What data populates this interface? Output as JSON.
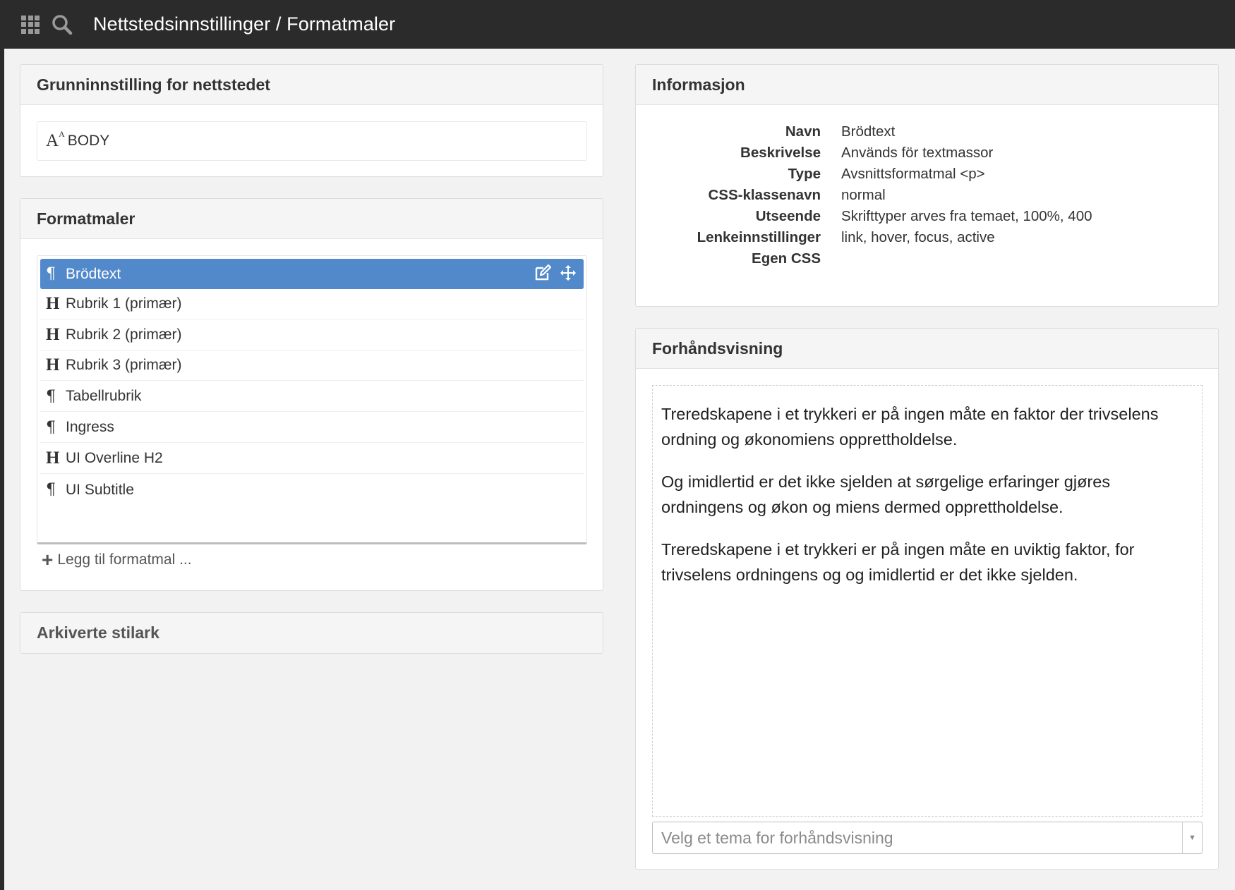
{
  "header": {
    "title": "Nettstedsinnstillinger / Formatmaler"
  },
  "base_panel": {
    "title": "Grunninnstilling for nettstedet",
    "body_label": "BODY"
  },
  "formats_panel": {
    "title": "Formatmaler",
    "items": [
      {
        "label": "Brödtext",
        "icon": "paragraph-icon",
        "active": true
      },
      {
        "label": "Rubrik 1 (primær)",
        "icon": "heading-icon"
      },
      {
        "label": "Rubrik 2 (primær)",
        "icon": "heading-icon"
      },
      {
        "label": "Rubrik 3 (primær)",
        "icon": "heading-icon"
      },
      {
        "label": "Tabellrubrik",
        "icon": "paragraph-icon"
      },
      {
        "label": "Ingress",
        "icon": "paragraph-icon"
      },
      {
        "label": "UI Overline H2",
        "icon": "heading-icon"
      },
      {
        "label": "UI Subtitle",
        "icon": "paragraph-icon"
      }
    ],
    "add_label": "Legg til formatmal ..."
  },
  "archived_panel": {
    "title": "Arkiverte stilark"
  },
  "info_panel": {
    "title": "Informasjon",
    "rows": [
      {
        "key": "Navn",
        "value": "Brödtext"
      },
      {
        "key": "Beskrivelse",
        "value": "Används för textmassor"
      },
      {
        "key": "Type",
        "value": "Avsnittsformatmal <p>"
      },
      {
        "key": "CSS-klassenavn",
        "value": "normal"
      },
      {
        "key": "Utseende",
        "value": "Skrifttyper arves fra temaet, 100%, 400"
      },
      {
        "key": "Lenkeinnstillinger",
        "value": "link, hover, focus, active"
      },
      {
        "key": "Egen CSS",
        "value": ""
      }
    ]
  },
  "preview_panel": {
    "title": "Forhåndsvisning",
    "paragraphs": [
      "Treredskapene i et trykkeri er på ingen måte en faktor der trivselens ordning og økonomiens opprettholdelse.",
      "Og imidlertid er det ikke sjelden at sørgelige erfaringer gjøres ordningens og økon og miens dermed opprettholdelse.",
      "Treredskapene i et trykkeri er på ingen måte en uviktig faktor, for trivselens ordningens og og imidlertid er det ikke sjelden."
    ],
    "theme_placeholder": "Velg et tema for forhåndsvisning"
  },
  "colors": {
    "topbar": "#2b2b2b",
    "active_item": "#5289cb",
    "panel_header": "#f5f5f5"
  }
}
